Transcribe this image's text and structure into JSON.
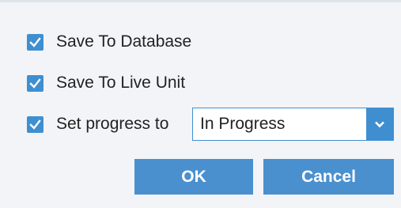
{
  "options": [
    {
      "label": "Save To Database",
      "checked": true
    },
    {
      "label": "Save To Live Unit",
      "checked": true
    },
    {
      "label": "Set progress to",
      "checked": true
    }
  ],
  "progress_select": {
    "selected": "In Progress",
    "icon": "chevron-down-icon"
  },
  "buttons": {
    "ok_label": "OK",
    "cancel_label": "Cancel"
  },
  "colors": {
    "accent": "#3f8fd0",
    "button": "#4a90cf",
    "background": "#f2f4f8"
  }
}
